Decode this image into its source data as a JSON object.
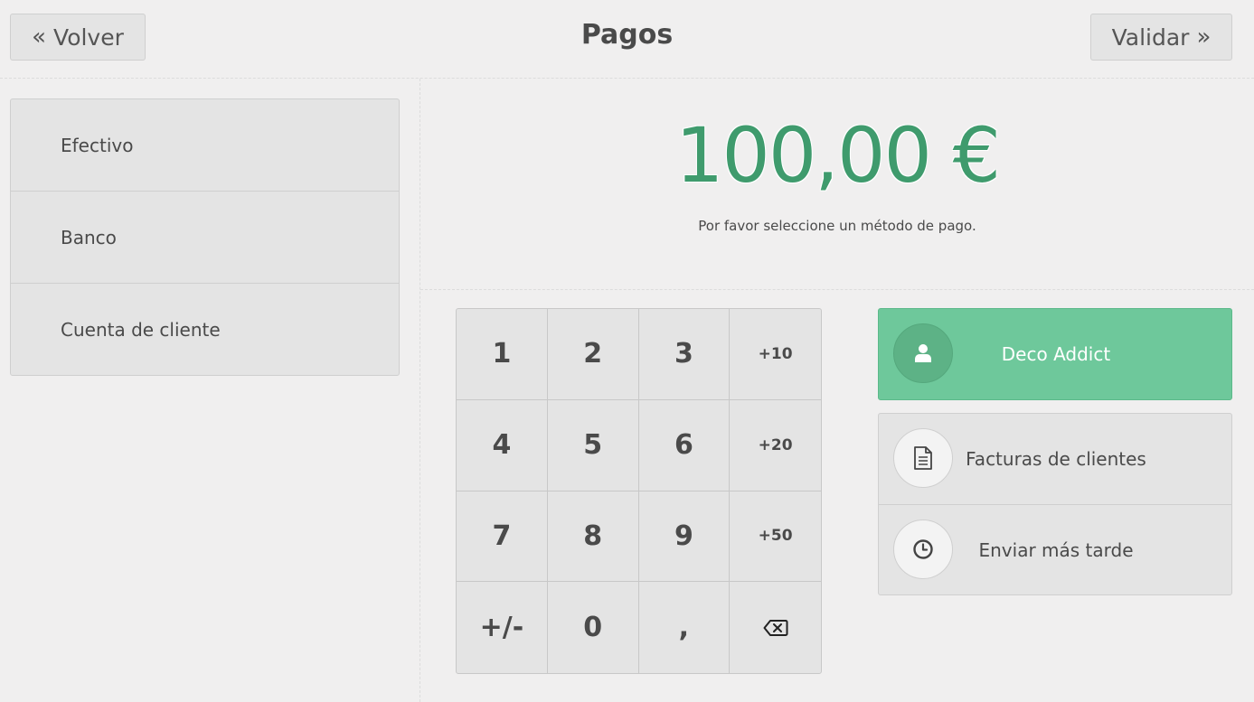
{
  "header": {
    "back_label": "Volver",
    "title": "Pagos",
    "validate_label": "Validar"
  },
  "payment_methods": [
    "Efectivo",
    "Banco",
    "Cuenta de cliente"
  ],
  "summary": {
    "amount": "100,00 €",
    "hint": "Por favor seleccione un método de pago."
  },
  "numpad": {
    "keys": [
      "1",
      "2",
      "3",
      "+10",
      "4",
      "5",
      "6",
      "+20",
      "7",
      "8",
      "9",
      "+50",
      "+/-",
      "0",
      ","
    ]
  },
  "customer": {
    "name": "Deco Addict"
  },
  "options": {
    "invoice_label": "Facturas de clientes",
    "send_later_label": "Enviar más tarde"
  },
  "colors": {
    "accent_green": "#3f9b6d",
    "customer_bg": "#6ec89b"
  }
}
